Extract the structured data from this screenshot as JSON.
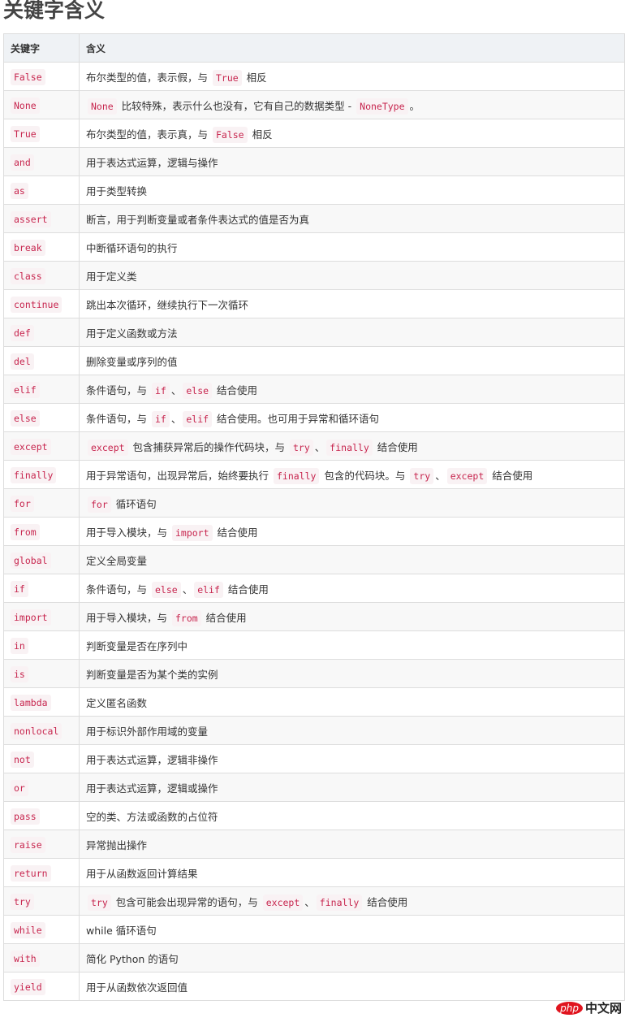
{
  "title": "关键字含义",
  "headers": [
    "关键字",
    "含义"
  ],
  "rows": [
    {
      "k": "False",
      "d": [
        {
          "t": "布尔类型的值，表示假，与 "
        },
        {
          "c": "True"
        },
        {
          "t": " 相反"
        }
      ]
    },
    {
      "k": "None",
      "d": [
        {
          "c": "None"
        },
        {
          "t": " 比较特殊，表示什么也没有，它有自己的数据类型 - "
        },
        {
          "c": "NoneType"
        },
        {
          "t": "。"
        }
      ]
    },
    {
      "k": "True",
      "d": [
        {
          "t": "布尔类型的值，表示真，与 "
        },
        {
          "c": "False"
        },
        {
          "t": " 相反"
        }
      ]
    },
    {
      "k": "and",
      "d": [
        {
          "t": "用于表达式运算，逻辑与操作"
        }
      ]
    },
    {
      "k": "as",
      "d": [
        {
          "t": "用于类型转换"
        }
      ]
    },
    {
      "k": "assert",
      "d": [
        {
          "t": "断言，用于判断变量或者条件表达式的值是否为真"
        }
      ]
    },
    {
      "k": "break",
      "d": [
        {
          "t": "中断循环语句的执行"
        }
      ]
    },
    {
      "k": "class",
      "d": [
        {
          "t": "用于定义类"
        }
      ]
    },
    {
      "k": "continue",
      "d": [
        {
          "t": "跳出本次循环，继续执行下一次循环"
        }
      ]
    },
    {
      "k": "def",
      "d": [
        {
          "t": "用于定义函数或方法"
        }
      ]
    },
    {
      "k": "del",
      "d": [
        {
          "t": "删除变量或序列的值"
        }
      ]
    },
    {
      "k": "elif",
      "d": [
        {
          "t": "条件语句，与 "
        },
        {
          "c": "if"
        },
        {
          "t": "、"
        },
        {
          "c": "else"
        },
        {
          "t": " 结合使用"
        }
      ]
    },
    {
      "k": "else",
      "d": [
        {
          "t": "条件语句，与 "
        },
        {
          "c": "if"
        },
        {
          "t": "、"
        },
        {
          "c": "elif"
        },
        {
          "t": " 结合使用。也可用于异常和循环语句"
        }
      ]
    },
    {
      "k": "except",
      "d": [
        {
          "c": "except"
        },
        {
          "t": " 包含捕获异常后的操作代码块，与 "
        },
        {
          "c": "try"
        },
        {
          "t": "、"
        },
        {
          "c": "finally"
        },
        {
          "t": " 结合使用"
        }
      ]
    },
    {
      "k": "finally",
      "d": [
        {
          "t": "用于异常语句，出现异常后，始终要执行 "
        },
        {
          "c": "finally"
        },
        {
          "t": " 包含的代码块。与 "
        },
        {
          "c": "try"
        },
        {
          "t": "、"
        },
        {
          "c": "except"
        },
        {
          "t": " 结合使用"
        }
      ]
    },
    {
      "k": "for",
      "d": [
        {
          "c": "for"
        },
        {
          "t": " 循环语句"
        }
      ]
    },
    {
      "k": "from",
      "d": [
        {
          "t": "用于导入模块，与 "
        },
        {
          "c": "import"
        },
        {
          "t": " 结合使用"
        }
      ]
    },
    {
      "k": "global",
      "d": [
        {
          "t": "定义全局变量"
        }
      ]
    },
    {
      "k": "if",
      "d": [
        {
          "t": "条件语句，与 "
        },
        {
          "c": "else"
        },
        {
          "t": "、"
        },
        {
          "c": "elif"
        },
        {
          "t": " 结合使用"
        }
      ]
    },
    {
      "k": "import",
      "d": [
        {
          "t": "用于导入模块，与 "
        },
        {
          "c": "from"
        },
        {
          "t": " 结合使用"
        }
      ]
    },
    {
      "k": "in",
      "d": [
        {
          "t": "判断变量是否在序列中"
        }
      ]
    },
    {
      "k": "is",
      "d": [
        {
          "t": "判断变量是否为某个类的实例"
        }
      ]
    },
    {
      "k": "lambda",
      "d": [
        {
          "t": "定义匿名函数"
        }
      ]
    },
    {
      "k": "nonlocal",
      "d": [
        {
          "t": "用于标识外部作用域的变量"
        }
      ]
    },
    {
      "k": "not",
      "d": [
        {
          "t": "用于表达式运算，逻辑非操作"
        }
      ]
    },
    {
      "k": "or",
      "d": [
        {
          "t": "用于表达式运算，逻辑或操作"
        }
      ]
    },
    {
      "k": "pass",
      "d": [
        {
          "t": "空的类、方法或函数的占位符"
        }
      ]
    },
    {
      "k": "raise",
      "d": [
        {
          "t": "异常抛出操作"
        }
      ]
    },
    {
      "k": "return",
      "d": [
        {
          "t": "用于从函数返回计算结果"
        }
      ]
    },
    {
      "k": "try",
      "d": [
        {
          "c": "try"
        },
        {
          "t": " 包含可能会出现异常的语句，与 "
        },
        {
          "c": "except"
        },
        {
          "t": "、"
        },
        {
          "c": "finally"
        },
        {
          "t": " 结合使用"
        }
      ]
    },
    {
      "k": "while",
      "d": [
        {
          "t": "while 循环语句"
        }
      ]
    },
    {
      "k": "with",
      "d": [
        {
          "t": "简化 Python 的语句"
        }
      ]
    },
    {
      "k": "yield",
      "d": [
        {
          "t": "用于从函数依次返回值"
        }
      ]
    }
  ],
  "watermark": {
    "php": "php",
    "cn": "中文网"
  }
}
